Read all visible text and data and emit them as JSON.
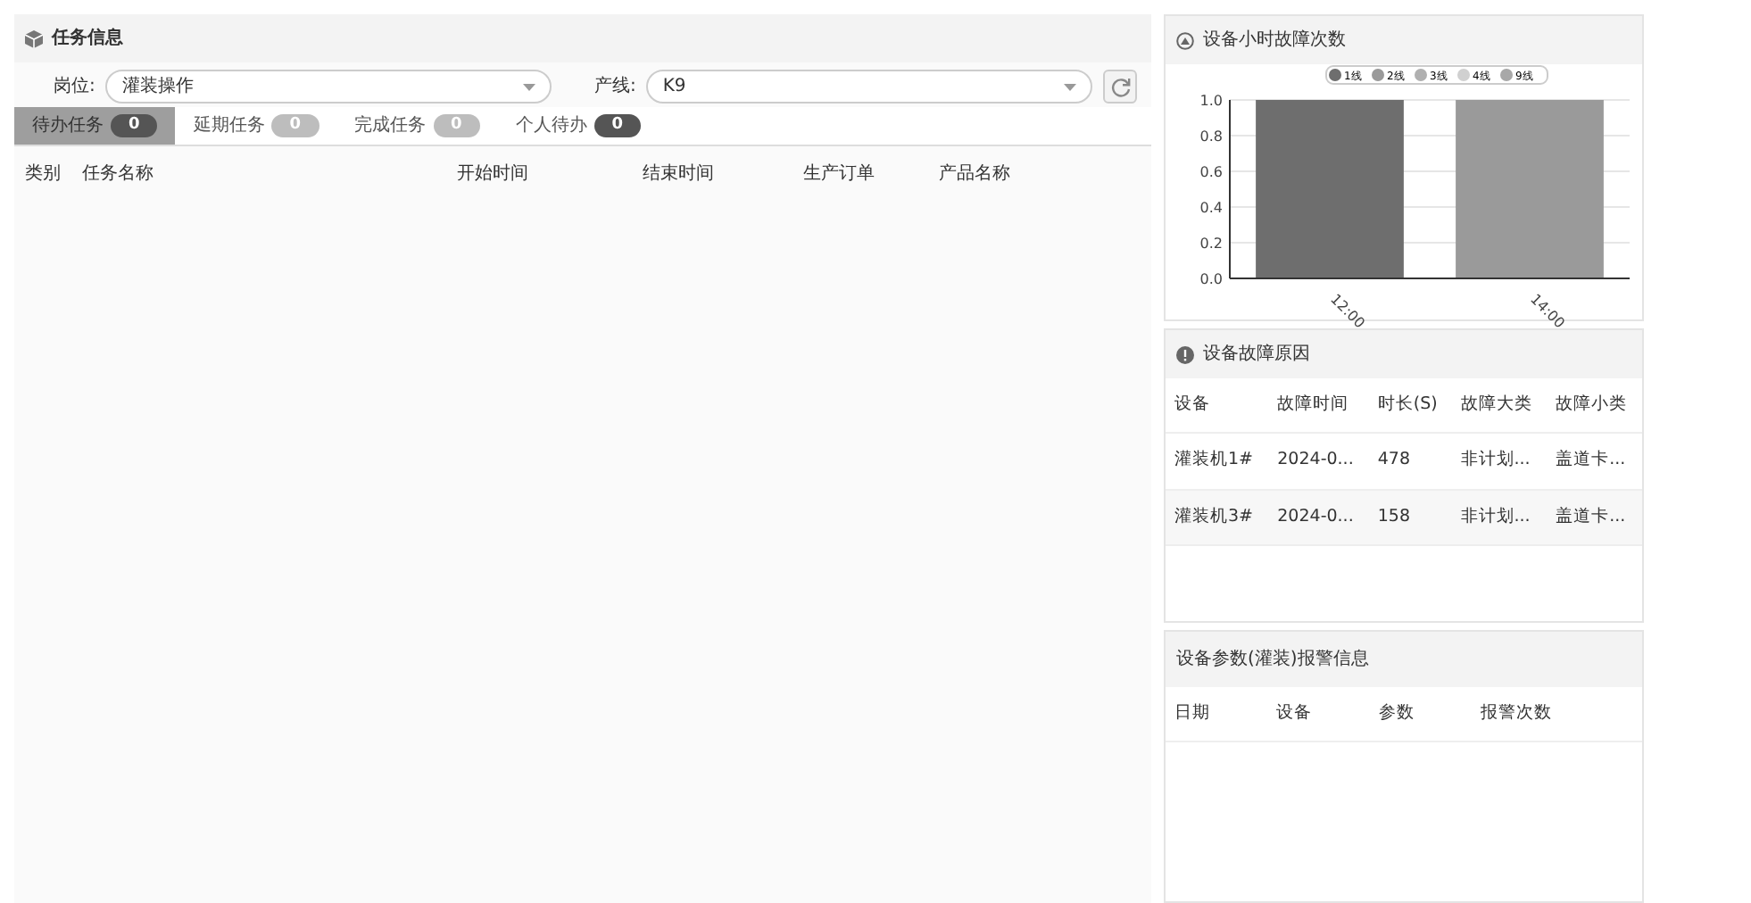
{
  "task_panel": {
    "title": "任务信息",
    "filters": [
      {
        "label": "岗位:",
        "value": "灌装操作"
      },
      {
        "label": "产线:",
        "value": "K9"
      }
    ],
    "tabs": [
      {
        "label": "待办任务",
        "count": "0",
        "selected": true,
        "kind": "dark"
      },
      {
        "label": "延期任务",
        "count": "0",
        "selected": false,
        "kind": "light"
      },
      {
        "label": "完成任务",
        "count": "0",
        "selected": false,
        "kind": "light"
      },
      {
        "label": "个人待办",
        "count": "0",
        "selected": false,
        "kind": "dark"
      }
    ],
    "columns": [
      "类别",
      "任务名称",
      "开始时间",
      "结束时间",
      "生产订单",
      "产品名称"
    ]
  },
  "hourly_faults": {
    "title": "设备小时故障次数",
    "chart_data": {
      "type": "bar",
      "stacked": true,
      "categories": [
        "12:00",
        "14:00"
      ],
      "yticks": [
        {
          "value": 0,
          "label": "0.0"
        },
        0.2,
        0.4,
        0.6,
        0.8,
        {
          "value": 1,
          "label": "1.0"
        }
      ],
      "grid": true,
      "legend": true,
      "ylim": [
        0,
        1
      ],
      "series": [
        {
          "name": "1线",
          "color": "#6e6e6e",
          "values": [
            1,
            null
          ]
        },
        {
          "name": "2线",
          "color": "#9a9a9a",
          "values": [
            null,
            1
          ]
        },
        {
          "name": "3线",
          "color": "#b0b0b0",
          "values": [
            null,
            null
          ]
        },
        {
          "name": "4线",
          "color": "#d0d0d0",
          "values": [
            null,
            null
          ]
        },
        {
          "name": "9线",
          "color": "#a8a8a8",
          "values": [
            null,
            null
          ]
        }
      ]
    }
  },
  "fault_reasons": {
    "title": "设备故障原因",
    "columns": [
      "设备",
      "故障时间",
      "时长(S)",
      "故障大类",
      "故障小类"
    ],
    "rows": [
      [
        "灌装机1#",
        "2024-0...",
        "478",
        "非计划...",
        "盖道卡..."
      ],
      [
        "灌装机3#",
        "2024-0...",
        "158",
        "非计划...",
        "盖道卡..."
      ]
    ]
  },
  "alarms": {
    "title": "设备参数(灌装)报警信息",
    "columns": [
      "日期",
      "设备",
      "参数",
      "报警次数"
    ]
  }
}
